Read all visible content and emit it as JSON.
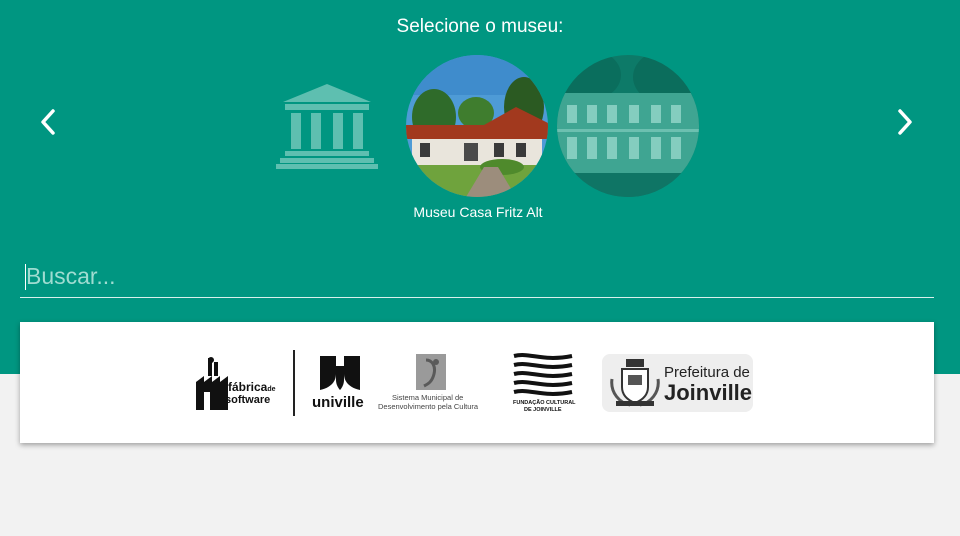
{
  "header": {
    "title": "Selecione o museu:"
  },
  "carousel": {
    "prev_icon": "chevron-left-icon",
    "next_icon": "chevron-right-icon",
    "items": [
      {
        "type": "placeholder",
        "icon": "museum-building-icon"
      },
      {
        "type": "photo",
        "name": "Museu Casa Fritz Alt",
        "selected": true
      },
      {
        "type": "photo",
        "name": "",
        "dimmed": true
      }
    ],
    "selected_name": "Museu Casa Fritz Alt"
  },
  "search": {
    "placeholder": "Buscar..."
  },
  "partners": {
    "fabrica": {
      "line1": "fábrica",
      "line1_small": "de",
      "line2": "software"
    },
    "univille": {
      "name": "univille"
    },
    "smdc": {
      "line1": "Sistema Municipal de",
      "line2": "Desenvolvimento pela Cultura"
    },
    "fcj": {
      "line1": "FUNDAÇÃO CULTURAL",
      "line2": "DE JOINVILLE"
    },
    "prefeitura": {
      "line1": "Prefeitura de",
      "line2": "Joinville"
    }
  },
  "colors": {
    "primary": "#009681",
    "background": "#f2f2f2",
    "card": "#ffffff"
  }
}
